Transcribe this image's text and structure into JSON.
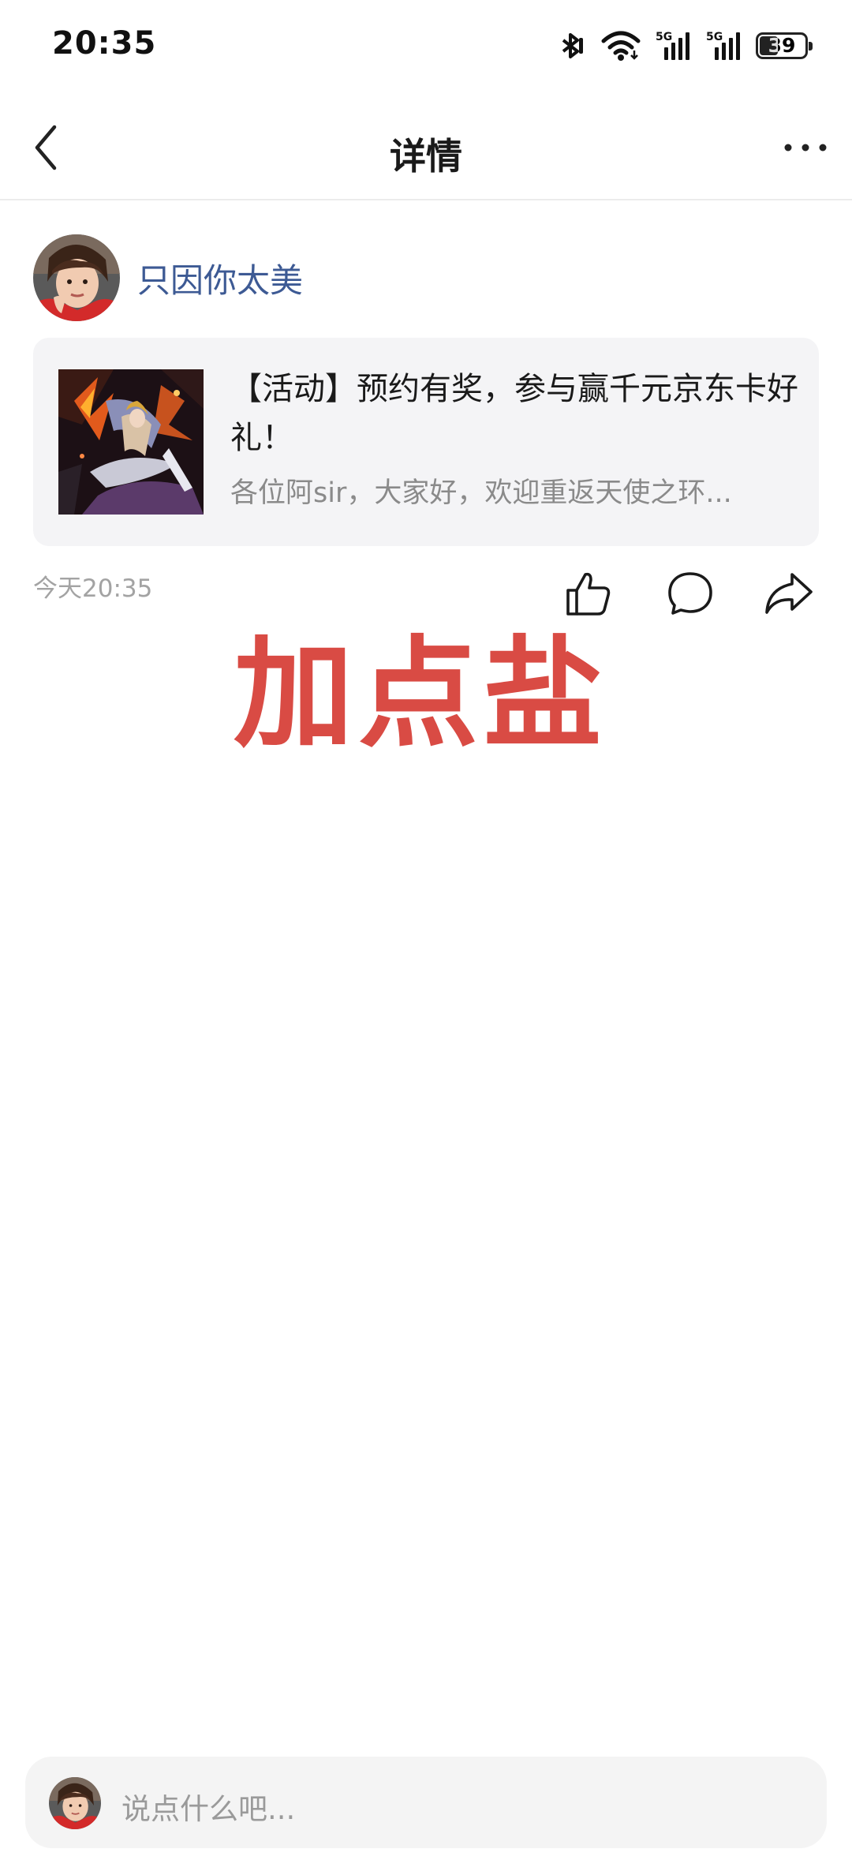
{
  "status_bar": {
    "time": "20:35",
    "battery_level": "39",
    "icons": [
      "bluetooth-icon",
      "wifi-icon",
      "signal-5g-icon",
      "signal-5g-icon",
      "battery-icon"
    ],
    "network_label_1": "5G",
    "network_label_2": "5G"
  },
  "nav": {
    "title": "详情",
    "back_icon": "chevron-left-icon",
    "more_icon": "more-horizontal-icon"
  },
  "post": {
    "author": {
      "name": "只因你太美",
      "avatar": "user-avatar"
    },
    "link_card": {
      "title": "【活动】预约有奖，参与赢千元京东卡好礼！",
      "summary": "各位阿sir，大家好，欢迎重返天使之环..."
    },
    "time": "今天20:35",
    "actions": [
      "thumbs-up-icon",
      "comment-icon",
      "share-icon"
    ],
    "text": "加点盐",
    "text_color": "#d94b44"
  },
  "comment_bar": {
    "placeholder": "说点什么吧..."
  },
  "colors": {
    "author_name": "#3d5a94",
    "card_background": "#f4f4f6",
    "muted_text": "#8a8a8a"
  }
}
